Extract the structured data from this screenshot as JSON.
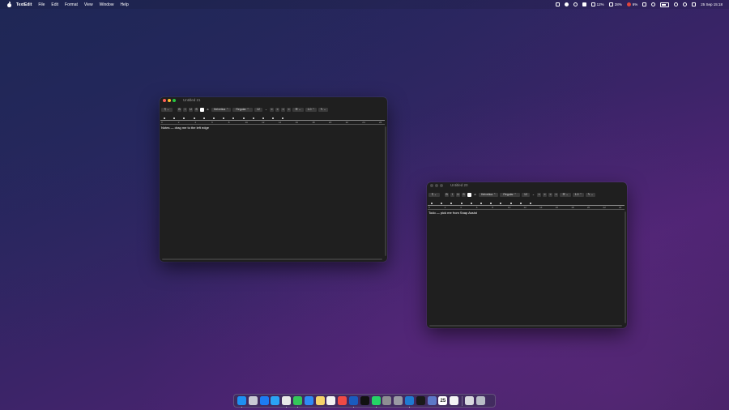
{
  "menubar": {
    "app_name": "TextEdit",
    "menus": [
      "File",
      "Edit",
      "Format",
      "View",
      "Window",
      "Help"
    ],
    "status": {
      "cpu_text": "12%",
      "mem_text": "28%",
      "fan_text": "6%",
      "datetime": "25 Sep 15:18"
    }
  },
  "windows": [
    {
      "title": "Untitled 21",
      "font_family": "Helvetica",
      "font_style": "Regular",
      "font_size": "12",
      "line_spacing": "1.0",
      "ruler_numbers": [
        "0",
        "2",
        "4",
        "6",
        "8",
        "10",
        "12",
        "14",
        "16",
        "18",
        "20",
        "22",
        "24",
        "26"
      ],
      "body_text": "Notes — drag me to the left edge"
    },
    {
      "title": "Untitled 20",
      "font_family": "Helvetica",
      "font_style": "Regular",
      "font_size": "12",
      "line_spacing": "1.0",
      "ruler_numbers": [
        "0",
        "2",
        "4",
        "6",
        "8",
        "10",
        "12",
        "14",
        "16",
        "18",
        "20",
        "22",
        "24"
      ],
      "body_text": "Todo — pick me from Snap Assist"
    }
  ],
  "dock": {
    "calendar_day": "25",
    "apps": [
      {
        "name": "finder-icon",
        "color": "#1e8ff2"
      },
      {
        "name": "launchpad-icon",
        "color": "#c9c9d4"
      },
      {
        "name": "app-store-icon",
        "color": "#1c7cf4"
      },
      {
        "name": "safari-icon",
        "color": "#2aa3f5"
      },
      {
        "name": "chrome-icon",
        "color": "#e8e8e8"
      },
      {
        "name": "messages-icon",
        "color": "#34c759"
      },
      {
        "name": "mail-icon",
        "color": "#2f8af5"
      },
      {
        "name": "notes-icon",
        "color": "#f5d36a"
      },
      {
        "name": "photos-icon",
        "color": "#f2f2f2"
      },
      {
        "name": "spark-icon",
        "color": "#ef4a45"
      },
      {
        "name": "xcode-icon",
        "color": "#1a5bbf"
      },
      {
        "name": "chat-icon",
        "color": "#111111"
      },
      {
        "name": "whatsapp-icon",
        "color": "#25d366"
      },
      {
        "name": "settings-icon",
        "color": "#8e8e93"
      },
      {
        "name": "archive-icon",
        "color": "#9a9aa4"
      },
      {
        "name": "vscode-icon",
        "color": "#1f7ad1"
      },
      {
        "name": "terminal-icon",
        "color": "#1a1a1a"
      },
      {
        "name": "screens-icon",
        "color": "#5d78c8"
      },
      {
        "name": "calendar-icon",
        "color": "#ffffff"
      },
      {
        "name": "reminders-icon",
        "color": "#f4f4f4"
      }
    ],
    "trailing": [
      {
        "name": "textedit-icon",
        "color": "#d8d8de"
      },
      {
        "name": "trash-icon",
        "color": "#b8bcc6"
      }
    ]
  }
}
